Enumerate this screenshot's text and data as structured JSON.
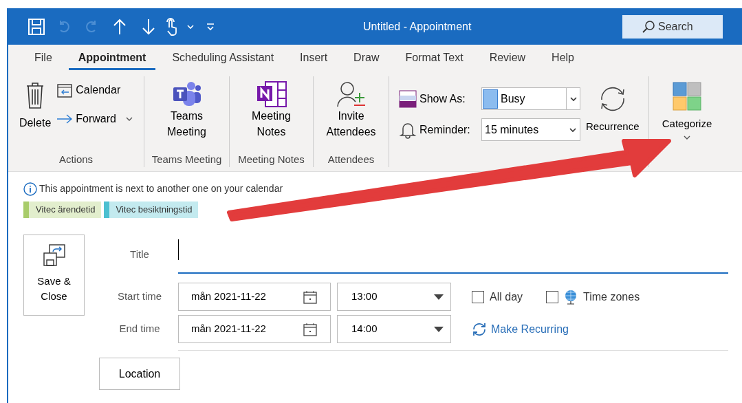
{
  "window": {
    "title": "Untitled  -  Appointment"
  },
  "search": {
    "placeholder": "Search"
  },
  "tabs": [
    {
      "label": "File",
      "selected": false
    },
    {
      "label": "Appointment",
      "selected": true
    },
    {
      "label": "Scheduling Assistant",
      "selected": false
    },
    {
      "label": "Insert",
      "selected": false
    },
    {
      "label": "Draw",
      "selected": false
    },
    {
      "label": "Format Text",
      "selected": false
    },
    {
      "label": "Review",
      "selected": false
    },
    {
      "label": "Help",
      "selected": false
    }
  ],
  "ribbon": {
    "actions": {
      "delete": "Delete",
      "calendar": "Calendar",
      "forward": "Forward",
      "label": "Actions"
    },
    "teams": {
      "button": "Teams Meeting",
      "label": "Teams Meeting"
    },
    "notes": {
      "button": "Meeting Notes",
      "label": "Meeting Notes"
    },
    "attendees": {
      "button": "Invite Attendees",
      "label": "Attendees"
    },
    "options": {
      "show_as_label": "Show As:",
      "show_as": "Busy",
      "reminder_label": "Reminder:",
      "reminder": "15 minutes",
      "recurrence": "Recurrence"
    },
    "tags": {
      "categorize": "Categorize"
    }
  },
  "info_message": "This appointment is next to another one on your calendar",
  "categories": [
    {
      "label": "Vitec ärendetid",
      "color": "#a8cc6a"
    },
    {
      "label": "Vitec besiktningstid",
      "color": "#4cc0d0"
    }
  ],
  "form": {
    "save_close": "Save & Close",
    "title_label": "Title",
    "start_label": "Start time",
    "start_date": "mån 2021-11-22",
    "start_time": "13:00",
    "end_label": "End time",
    "end_date": "mån 2021-11-22",
    "end_time": "14:00",
    "all_day": {
      "label": "All day",
      "checked": false
    },
    "time_zones": {
      "label": "Time zones",
      "checked": false
    },
    "make_recurring": "Make Recurring",
    "location": "Location"
  }
}
